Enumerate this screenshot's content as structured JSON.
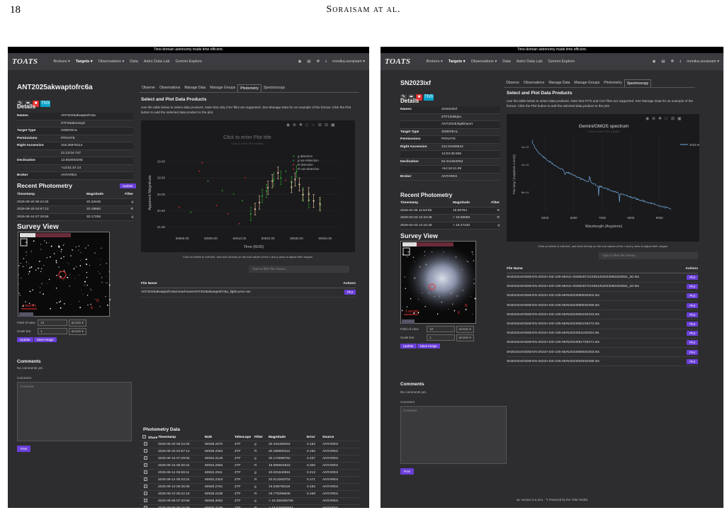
{
  "page": {
    "number": "18",
    "running_title": "Soraisam at al."
  },
  "left": {
    "banner": "Time-domain astronomy made time efficient.",
    "logo": "TOATS",
    "nav": [
      "Brokers ▾",
      "Targets ▾",
      "Observations ▾",
      "Data",
      "Astro Data Lab",
      "Gemini Explore"
    ],
    "user": "monika.soraisam ▾",
    "target_name": "ANT2025akwaptofrc6a",
    "tns_label": "TNS",
    "details_title": "Details",
    "details": [
      {
        "k": "Names",
        "v": "ANT2025akwaptofrc6a"
      },
      {
        "k": "",
        "v": "ZTF25abmveyd"
      },
      {
        "k": "Target Type",
        "v": "SIDEREAL"
      },
      {
        "k": "Permissions",
        "v": "PRIVATE"
      },
      {
        "k": "Right Ascension",
        "v": "318.26978114"
      },
      {
        "k": "",
        "v": "21:13:04.747"
      },
      {
        "k": "Declination",
        "v": "13.863093265"
      },
      {
        "k": "",
        "v": "+13:51:47.14"
      },
      {
        "k": "Broker",
        "v": "ANTARES"
      }
    ],
    "tabs": [
      "Observe",
      "Observations",
      "Manage Data",
      "Manage Groups",
      "Photometry",
      "Spectroscopy"
    ],
    "select_title": "Select and Plot Data Products",
    "select_desc": "Use the table below to select data products. Note that only CSV files are supported. See Manage Data for an example of the format. Click the Plot button to add the selected data product to the plot.",
    "recent_title": "Recent Photometry",
    "update_label": "Update",
    "recent_headers": [
      "Timestamp",
      "Magnitude",
      "Filter"
    ],
    "recent_rows": [
      [
        "2025-09-20 06:24:26",
        "20.33445",
        "g"
      ],
      [
        "2025-09-20 04:57:13",
        "20.28660",
        "R"
      ],
      [
        "2025-09-16 07:29:55",
        "20.17259",
        "g"
      ]
    ],
    "survey_title": "Survey View",
    "fov_label": "Field of view",
    "fov_val": "10",
    "fov_unit": "arcmin ▾",
    "scale_label": "Scale bar",
    "scale_val": "1",
    "scale_unit": "arcmin ▾",
    "update_btn": "Update",
    "save_btn": "Save Image",
    "plot_hint": "Click on labels to edit text, and click directly on the end values of the x and y axes to adjust their ranges.",
    "filter_placeholder": "Type to filter file names...",
    "files_headers": [
      "File Name",
      "Actions"
    ],
    "file_row": "ANT2025akwaptofrc6a/none/none/ANT2025akwaptofrc6a_lightcurve.csv",
    "plot_btn": "Plot",
    "comments_title": "Comments",
    "no_comments": "No comments yet.",
    "comment_label": "Comment",
    "comment_ph": "Comment",
    "post": "Post",
    "phot_title": "Photometry Data",
    "phot_headers": [
      "Share",
      "Timestamp",
      "MJD",
      "Telescope",
      "Filter",
      "Magnitude",
      "Error",
      "Source"
    ],
    "phot_rows": [
      [
        "2025-09-20 06:24:26",
        "60938.2670",
        "ZTF",
        "g",
        "20.334459304",
        "0.182",
        "ANTARES"
      ],
      [
        "2025-09-20 04:57:13",
        "60938.2064",
        "ZTF",
        "R",
        "20.286600112",
        "0.192",
        "ANTARES"
      ],
      [
        "2025-09-16 07:29:55",
        "60934.3125",
        "ZTF",
        "g",
        "20.172599792",
        "0.237",
        "ANTARES"
      ],
      [
        "2025-09-16 06:26:34",
        "60934.2684",
        "ZTF",
        "R",
        "19.995904922",
        "0.200",
        "ANTARES"
      ],
      [
        "2025-09-14 06:59:11",
        "60932.2911",
        "ZTF",
        "g",
        "20.001840591",
        "0.213",
        "ANTARES"
      ],
      [
        "2025-09-14 05:34:31",
        "60932.2323",
        "ZTF",
        "R",
        "20.013263702",
        "0.171",
        "ANTARES"
      ],
      [
        "2025-09-10 06:36:06",
        "60928.2751",
        "ZTF",
        "g",
        "19.639799118",
        "0.182",
        "ANTARES"
      ],
      [
        "2025-09-10 05:22:16",
        "60928.2238",
        "ZTF",
        "R",
        "19.778396606",
        "0.168",
        "ANTARES"
      ],
      [
        "2025-09-08 07:20:58",
        "60926.3062",
        "ZTF",
        "g",
        "> 19.305299758",
        "",
        "ANTARES"
      ],
      [
        "2025-09-08 05:15:08",
        "60926.2188",
        "ZTF",
        "R",
        "> 19.576999664",
        "",
        "ANTARES"
      ]
    ],
    "plot": {
      "title": "Click to enter Plot title",
      "subtitle": "Click to enter Plot subtitle",
      "xlabel": "Time (MJD)",
      "ylabel": "Apparent Magnitude",
      "xticks": [
        "60890.00",
        "60900.00",
        "60910.00",
        "60920.00",
        "60930.00",
        "60940.00"
      ],
      "yticks": [
        "19.00",
        "19.50",
        "20.00",
        "20.50",
        "21.00"
      ],
      "legend": [
        "g detection",
        "g non-detection",
        "R detection",
        "R non-detection"
      ],
      "colors": {
        "g": "#2ca02c",
        "R": "#d62728",
        "Rdet": "#f2c7a6"
      }
    }
  },
  "right": {
    "banner": "Time-domain astronomy made time efficient.",
    "logo": "TOATS",
    "nav": [
      "Brokers ▾",
      "Targets ▾",
      "Observations ▾",
      "Data",
      "Astro Data Lab",
      "Gemini Explore"
    ],
    "user": "monika.soraisam ▾",
    "target_name": "SN2023ixf",
    "tns_label": "TNS",
    "details_title": "Details",
    "details": [
      {
        "k": "Names",
        "v": "SN2023ixf"
      },
      {
        "k": "",
        "v": "ZTF23aklqsu"
      },
      {
        "k": "",
        "v": "ANT2023l4lg8bhp4rt"
      },
      {
        "k": "Target Type",
        "v": "SIDEREAL"
      },
      {
        "k": "Permissions",
        "v": "PRIVATE"
      },
      {
        "k": "Right Ascension",
        "v": "210.91066843"
      },
      {
        "k": "",
        "v": "14:03:38.565"
      },
      {
        "k": "Declination",
        "v": "54.311664053"
      },
      {
        "k": "",
        "v": "+54:18:41.99"
      },
      {
        "k": "Broker",
        "v": "ANTARES"
      }
    ],
    "tabs": [
      "Observe",
      "Observations",
      "Manage Data",
      "Manage Groups",
      "Photometry",
      "Spectroscopy"
    ],
    "select_title": "Select and Plot Data Products",
    "select_desc": "Use the table below to select data products. Note that FITS and CSV files are supported. See Manage Data for an example of the format. Click the Plot button to add the selected data product to the plot.",
    "recent_title": "Recent Photometry",
    "recent_headers": [
      "Timestamp",
      "Magnitude",
      "Filter"
    ],
    "recent_rows": [
      [
        "2026-02-05 11:53:05",
        "19.60764",
        "R"
      ],
      [
        "2026-02-03 12:43:48",
        "> 19.56659",
        "R"
      ],
      [
        "2026-02-03 12:15:46",
        "> 19.27420",
        "g"
      ]
    ],
    "survey_title": "Survey View",
    "fov_label": "Field of view",
    "fov_val": "10",
    "fov_unit": "arcmin ▾",
    "scale_label": "Scale bar",
    "scale_val": "1",
    "scale_unit": "arcmin ▾",
    "update_btn": "Update",
    "save_btn": "Save Image",
    "plot_hint": "Click on labels to edit text, and click directly on the end values of the x and y axes to adjust their ranges.",
    "filter_placeholder": "Type to filter file names...",
    "files_headers": [
      "File Name",
      "Actions"
    ],
    "files": [
      "SN2023ixf/GEM/GN-2023A-DD-105-65/run-20260407215351/N20230603S0054_2D.fits",
      "SN2023ixf/GEM/GN-2023A-DD-105-65/run-20260407215351/N20230603S0054_1D.fits",
      "SN2023ixf/GEM/GN-2023A-DD-105-65/N20230605S0402.fits",
      "SN2023ixf/GEM/GN-2023A-DD-105-65/N20230605S0456.fits",
      "SN2023ixf/GEM/GN-2023A-DD-105-65/N20230602S0153.fits",
      "SN2023ixf/GEM/GN-2023A-DD-105-65/N20230601S0272.fits",
      "SN2023ixf/GEM/GN-2023A-DD-105-65/N20230611S0204.fits",
      "SN2023ixf/GEM/GN-2023A-DD-105-65/N20230617S0271.fits",
      "SN2023ixf/GEM/GN-2023A-DD-105-65/N20230605S0403.fits",
      "SN2023ixf/GEM/GN-2023A-DD-105-65/N20230625S0286.fits"
    ],
    "plot_btn": "Plot",
    "comments_title": "Comments",
    "no_comments": "No comments yet.",
    "comment_label": "Comment",
    "comment_ph": "Comment",
    "post": "Post",
    "footer": "tw. Version 2.6.3rc1 · ✎ Powered by the TOM Toolkit",
    "spec": {
      "title": "Gemini/GMOS spectrum",
      "subtitle": "Click to enter Plot subtitle",
      "xlabel": "Wavelength (Angstrom)",
      "ylabel": "Flux (erg / (Angstrom s cm2))",
      "xticks": [
        "5000",
        "6000",
        "7000",
        "8000",
        "9000"
      ],
      "yticks": [
        "1e-13",
        "1e-13",
        "8e-14"
      ],
      "legend": "2023-06-03",
      "color": "#6fa8dc"
    }
  }
}
